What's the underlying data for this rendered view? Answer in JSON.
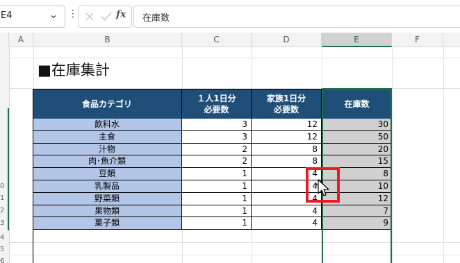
{
  "formula_bar": {
    "name_box": "E4",
    "more_glyph": "⋮",
    "cancel_icon": "cancel-icon",
    "enter_icon": "enter-icon",
    "fx_label": "fx",
    "formula_value": "在庫数"
  },
  "sheet": {
    "columns": [
      "A",
      "B",
      "C",
      "D",
      "E",
      "F"
    ],
    "selected_column": "E",
    "row_numbers": [
      "",
      "",
      "",
      "",
      "",
      "",
      "",
      "",
      "",
      "0",
      "1",
      "2",
      "3",
      "4",
      "5",
      "6"
    ],
    "title": "■在庫集計",
    "table": {
      "headers": [
        "食品カテゴリ",
        "１人1日分\n必要数",
        "家族1日分\n必要数",
        "在庫数"
      ],
      "rows": [
        {
          "category": "飲料水",
          "per_person": "3",
          "family": "12",
          "stock": "30"
        },
        {
          "category": "主食",
          "per_person": "3",
          "family": "12",
          "stock": "50"
        },
        {
          "category": "汁物",
          "per_person": "2",
          "family": "8",
          "stock": "20"
        },
        {
          "category": "肉･魚介類",
          "per_person": "2",
          "family": "8",
          "stock": "15"
        },
        {
          "category": "豆類",
          "per_person": "1",
          "family": "4",
          "stock": "8"
        },
        {
          "category": "乳製品",
          "per_person": "1",
          "family": "4",
          "stock": "10"
        },
        {
          "category": "野菜類",
          "per_person": "1",
          "family": "4",
          "stock": "12"
        },
        {
          "category": "果物類",
          "per_person": "1",
          "family": "4",
          "stock": "7"
        },
        {
          "category": "菓子類",
          "per_person": "1",
          "family": "4",
          "stock": "9"
        }
      ]
    }
  },
  "colors": {
    "header_bg": "#1f4e79",
    "category_bg": "#b4c6e7",
    "stock_bg": "#d0d0d0",
    "selection": "#1e7145",
    "annotation": "#e81c24"
  }
}
